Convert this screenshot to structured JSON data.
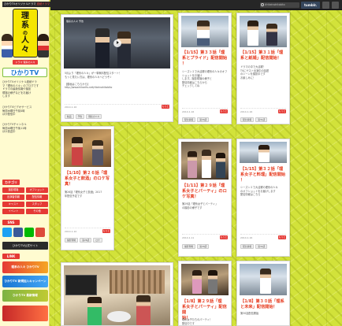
{
  "sidebar": {
    "topbar_text": "ひかりTVオリジナルドラマ",
    "topbar_accent": "連続ドラマ",
    "logo": {
      "line1": "理",
      "line2": "系",
      "line3": "の",
      "line4": "人",
      "line5": "々",
      "subtitle": "ドラマ 理系の人々"
    },
    "brand": "ひかりTV",
    "intro_lines": [
      "ひかりTVオリジナル連続ドラ",
      "マ「理系の人々」のブログです",
      "ドラマの最新情報や撮影",
      "現場の様子などをお届け",
      "します"
    ],
    "info_lines": [
      "ひかりTVビデオサービス",
      "毎週木曜日午前0時",
      "ほか配信中"
    ],
    "channel_lines": [
      "ひかりTVチャンネル",
      "毎週木曜日午後11時",
      "ほか放送中"
    ],
    "category_heading": "カテゴリ",
    "categories": [
      "撮影現場",
      "オフショット",
      "出演者情報",
      "配信情報",
      "キャスト",
      "スタッフ",
      "イベント",
      "その他"
    ],
    "share_heading": "SNS",
    "follow_heading": "LINK",
    "dark_button": "ひかりTV公式サイト",
    "banner_1": "理系の人々 ひかりTV",
    "banner_2": "ひかりTV 新規加入キャンペーン",
    "banner_3": "ひかりTV 最新情報"
  },
  "topbar": {
    "search_placeholder": "#rikeinohitobito",
    "tumblr_label": "tumblr."
  },
  "cards": [
    {
      "video_caption": "理系の人々 予告",
      "body": "5月より「理系の人々」が一挙無料配信スタート！\nもっと見たい方は、理系の人々へどうぞ♪\n\n【動画はこちらから】\nhttp://www.hikaritv.net/rikeinohitobito",
      "date": "2014.1.16",
      "tags": [
        "動画",
        "予告",
        "理系の人々"
      ],
      "more": "もっと"
    },
    {
      "title": "【1/15】第３３話「理\n系とプライド」配信開始\n！",
      "body": "シーズン２で大活躍の理系の人々のオフショットをお届け\nします。撮影現場の様子と\n配信情報はこちらから\nチェックしてね",
      "date": "2014.1.16",
      "tags": [
        "配信情報",
        "第33話"
      ],
      "more": "もっと"
    },
    {
      "title": "【1/15】第３１話「理\n系と紙婚」配信開始！",
      "body": "ドラマの中で大活躍！\nTVにゲスト出演中の話題\nのシーンを撮影中です\nお楽しみに！",
      "date": "2014.1.16",
      "tags": [
        "配信情報",
        "第31話"
      ],
      "more": "もっと"
    },
    {
      "title": "【1/10】第２６話「理\n系女子と飲酒」のロケ写\n真！",
      "body": "第26話「理系女子と飲酒」2017\n年配信予定です",
      "date": "2014.1.10",
      "tags": [
        "撮影現場",
        "第26話",
        "ロケ"
      ],
      "more": "もっと"
    },
    {
      "title": "【1/11】第２９話「理\n系女子とパーティ」のロ\nケ写真！",
      "body": "第29話「理系女子とパーティ」\nの撮影の様子です",
      "date": "2014.1.11",
      "tags": [
        "撮影現場",
        "第29話"
      ],
      "more": "もっと"
    },
    {
      "title": "【1/15】第３２話「理\n系女子と料理」配信開始\n！",
      "body": "シーズン２で大活躍の理系の人々\nのオフショットをお届けします\n配信情報はこちら",
      "date": "2014.1.16",
      "tags": [
        "配信情報",
        "第32話"
      ],
      "more": "もっと"
    },
    {
      "title": "【1/8】第２９話「理\n系女子とパーティ」配信開\n始！",
      "body": "理系女子たちのパーティ！\n配信中です",
      "date": "2014.1.8",
      "tags": [
        "配信情報"
      ],
      "more": "もっと"
    },
    {
      "title": "【1/8】第３０話「理系\nと未来」配信開始！",
      "body": "第30話配信開始",
      "date": "2014.1.8",
      "tags": [
        "配信情報"
      ],
      "more": "もっと"
    }
  ]
}
